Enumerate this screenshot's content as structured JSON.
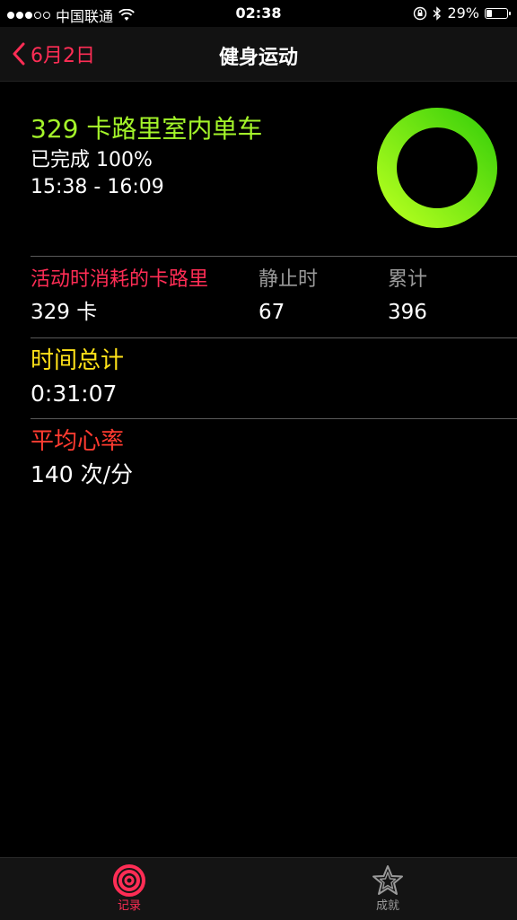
{
  "status_bar": {
    "carrier": "中国联通",
    "time": "02:38",
    "battery_percent": "29%",
    "battery_level": 0.29,
    "icons": [
      "signal-dots",
      "wifi-icon",
      "orientation-lock-icon",
      "bluetooth-icon",
      "battery-icon"
    ]
  },
  "nav": {
    "back_label": "6月2日",
    "title": "健身运动"
  },
  "summary": {
    "title": "329 卡路里室内单车",
    "completion": "已完成 100%",
    "time_range": "15:38 - 16:09",
    "progress": 1.0,
    "ring_colors": [
      "#3cd10a",
      "#b4ff1e"
    ]
  },
  "calories": {
    "active_label": "活动时消耗的卡路里",
    "active_value": "329 卡",
    "resting_label": "静止时",
    "resting_value": "67",
    "total_label": "累计",
    "total_value": "396"
  },
  "duration": {
    "label": "时间总计",
    "value": "0:31:07"
  },
  "heart_rate": {
    "label": "平均心率",
    "value": "140 次/分"
  },
  "tabs": [
    {
      "label": "记录",
      "icon": "activity-rings-icon",
      "active": true
    },
    {
      "label": "成就",
      "icon": "star-achievement-icon",
      "active": false
    }
  ],
  "colors": {
    "accent_red": "#ff2d55",
    "calorie_green": "#a4f52a",
    "duration_yellow": "#ffe219",
    "heart_orange": "#ff3b30"
  }
}
